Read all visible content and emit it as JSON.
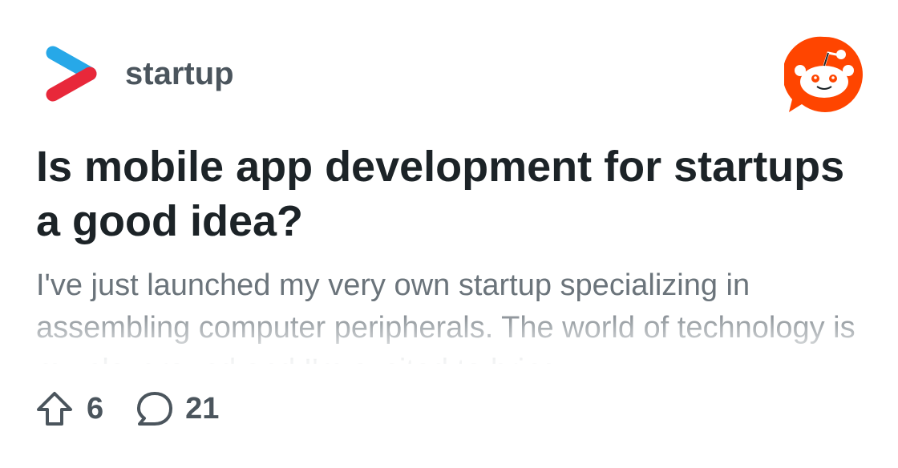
{
  "post": {
    "subreddit": "startup",
    "title": "Is mobile app development for startups a good idea?",
    "body": "I've just launched my very own startup specializing in assembling computer peripherals. The world of technology is my playground and I'm excited to bring"
  },
  "stats": {
    "upvotes": "6",
    "comments": "21"
  },
  "icons": {
    "subreddit": "chevron-play-icon",
    "brand": "reddit-logo",
    "upvote": "upvote-arrow-icon",
    "comment": "comment-bubble-icon"
  },
  "colors": {
    "brand_orange": "#ff4500",
    "icon_blue": "#27a8e8",
    "icon_red": "#e8283a",
    "title": "#1c2327",
    "body": "#6b747b",
    "meta": "#4b555d"
  }
}
